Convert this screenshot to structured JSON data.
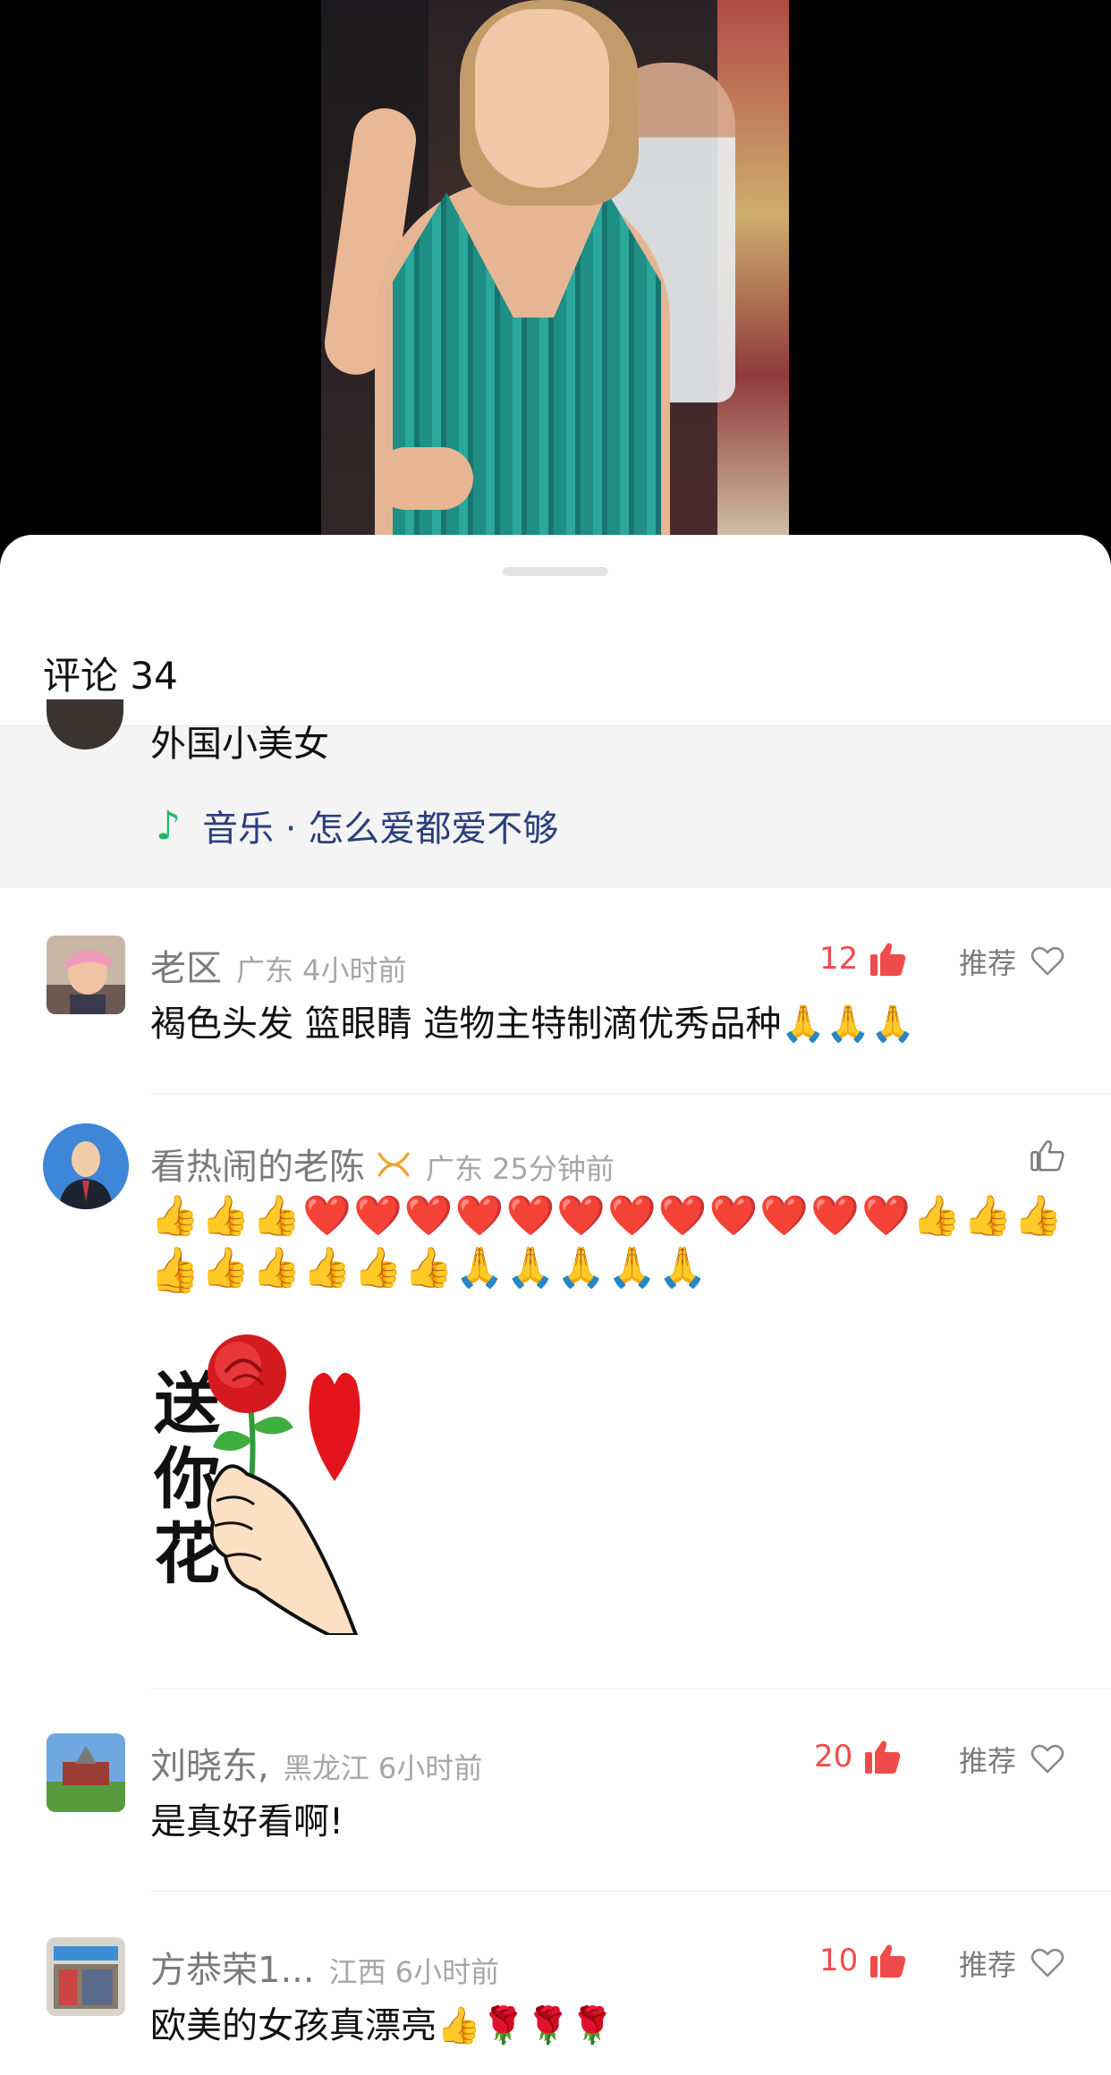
{
  "sheet": {
    "title": "评论 34"
  },
  "post": {
    "caption": "外国小美女",
    "music": "音乐 · 怎么爱都爱不够"
  },
  "comments": [
    {
      "name": "老区",
      "meta": "广东 4小时前",
      "text": "褐色头发 篮眼睛 造物主特制滴优秀品种🙏🙏🙏",
      "likes": "12",
      "rec_label": "推荐"
    },
    {
      "name": "看热闹的老陈",
      "meta": "广东 25分钟前",
      "badge": "ʘ",
      "emoji_line1": "👍👍👍❤️❤️❤️❤️❤️❤️❤️❤️❤️❤️❤️❤️👍👍👍👍",
      "emoji_line2": "👍👍👍👍👍👍🙏🙏🙏🙏🙏",
      "sticker_text": "送你花"
    },
    {
      "name": "刘晓东,",
      "meta": "黑龙江 6小时前",
      "text": "是真好看啊!",
      "likes": "20",
      "rec_label": "推荐"
    },
    {
      "name": "方恭荣1...",
      "meta": "江西 6小时前",
      "text": "欧美的女孩真漂亮👍🌹🌹🌹",
      "likes": "10",
      "rec_label": "推荐"
    }
  ],
  "colors": {
    "like_red": "#f04b4b",
    "music_green": "#1fb86a",
    "music_blue": "#2a3f7a"
  }
}
